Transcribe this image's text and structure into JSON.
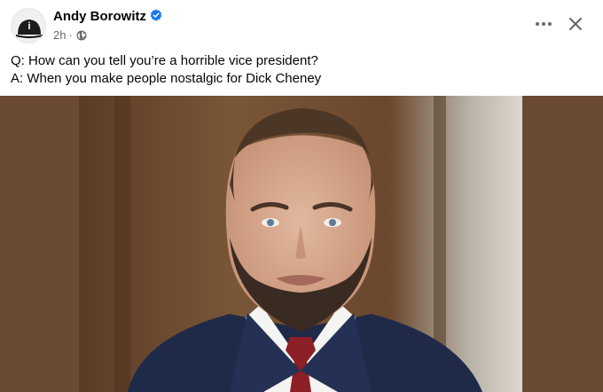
{
  "post": {
    "author": "Andy Borowitz",
    "time": "2h",
    "separator": "·",
    "audience_icon": "globe-icon",
    "verified_icon": "verified-badge-icon",
    "more_icon": "more-horizontal-icon",
    "close_icon": "close-icon",
    "lines": [
      "Q: How can you tell you’re a horrible vice president?",
      "A: When you make people nostalgic for Dick Cheney"
    ]
  },
  "colors": {
    "verified": "#1877f2",
    "secondary_text": "#65676b",
    "media_background": "#6b4a32"
  }
}
